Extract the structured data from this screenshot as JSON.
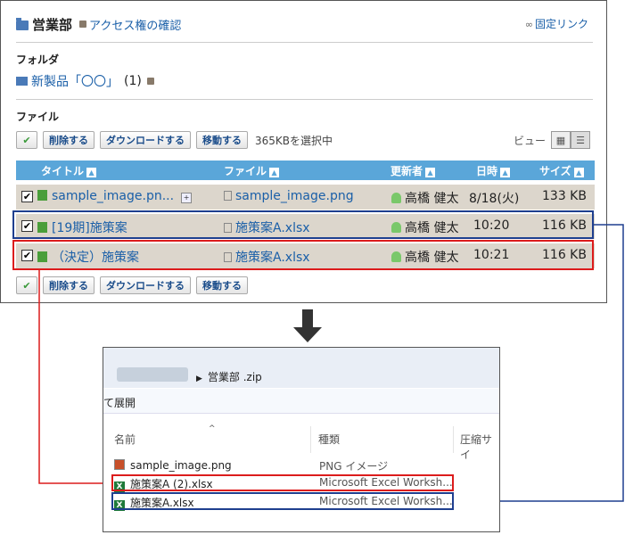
{
  "header": {
    "title": "営業部",
    "access_link": "アクセス権の確認",
    "fixed_link": "固定リンク"
  },
  "folder_section": {
    "label": "フォルダ",
    "subfolder_name": "新製品「〇〇」",
    "subfolder_count": "(1)"
  },
  "file_section": {
    "label": "ファイル"
  },
  "toolbar": {
    "check": "✔",
    "delete": "削除する",
    "download": "ダウンロードする",
    "move": "移動する",
    "selected_info": "365KBを選択中",
    "view_label": "ビュー"
  },
  "table": {
    "columns": {
      "title": "タイトル",
      "file": "ファイル",
      "updater": "更新者",
      "date": "日時",
      "size": "サイズ"
    },
    "rows": [
      {
        "title": "sample_image.pn...",
        "file": "sample_image.png",
        "updater": "高橋 健太",
        "date": "8/18(火)",
        "size": "133 KB"
      },
      {
        "title": "[19期]施策案",
        "file": "施策案A.xlsx",
        "updater": "高橋 健太",
        "date": "10:20",
        "size": "116 KB"
      },
      {
        "title": "（決定）施策案",
        "file": "施策案A.xlsx",
        "updater": "高橋 健太",
        "date": "10:21",
        "size": "116 KB"
      }
    ]
  },
  "explorer": {
    "path": "営業部 .zip",
    "expand_label": "て展開",
    "columns": {
      "name": "名前",
      "type": "種類",
      "compressed": "圧縮サイ"
    },
    "files": [
      {
        "name": "sample_image.png",
        "type": "PNG イメージ"
      },
      {
        "name": "施策案A (2).xlsx",
        "type": "Microsoft Excel Worksh..."
      },
      {
        "name": "施策案A.xlsx",
        "type": "Microsoft Excel Worksh..."
      }
    ]
  }
}
